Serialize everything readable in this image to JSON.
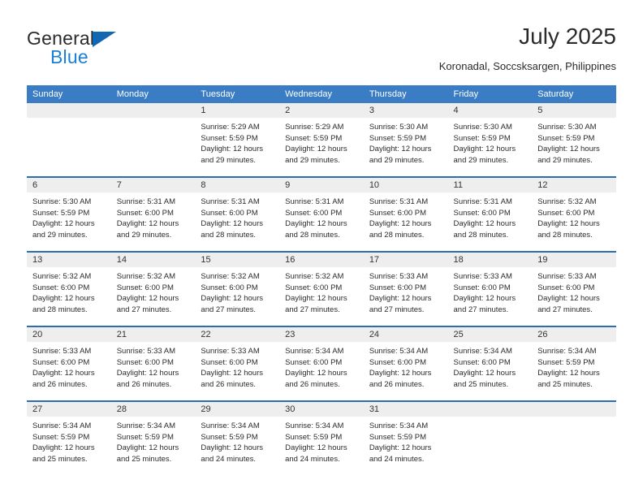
{
  "brand": {
    "name_part1": "General",
    "name_part2": "Blue",
    "triangle_icon": "triangle-icon",
    "colors": {
      "dark": "#2b2b2b",
      "blue": "#1b7fd4",
      "triangle": "#1167b1"
    }
  },
  "header": {
    "title": "July 2025",
    "subtitle": "Koronadal, Soccsksargen, Philippines"
  },
  "colors": {
    "header_row_bg": "#3b7dc4",
    "row_divider": "#2e6cb0",
    "date_band_bg": "#eeeeee",
    "cell_bg": "#ffffff",
    "text": "#2b2b2b"
  },
  "weekday_headers": [
    "Sunday",
    "Monday",
    "Tuesday",
    "Wednesday",
    "Thursday",
    "Friday",
    "Saturday"
  ],
  "labels": {
    "sunrise_prefix": "Sunrise:",
    "sunset_prefix": "Sunset:",
    "daylight_prefix": "Daylight:"
  },
  "weeks": [
    {
      "days": [
        {
          "date": "",
          "empty": true,
          "sunrise": "",
          "sunset": "",
          "daylight": ""
        },
        {
          "date": "",
          "empty": true,
          "sunrise": "",
          "sunset": "",
          "daylight": ""
        },
        {
          "date": "1",
          "empty": false,
          "sunrise": "Sunrise: 5:29 AM",
          "sunset": "Sunset: 5:59 PM",
          "daylight": "Daylight: 12 hours and 29 minutes."
        },
        {
          "date": "2",
          "empty": false,
          "sunrise": "Sunrise: 5:29 AM",
          "sunset": "Sunset: 5:59 PM",
          "daylight": "Daylight: 12 hours and 29 minutes."
        },
        {
          "date": "3",
          "empty": false,
          "sunrise": "Sunrise: 5:30 AM",
          "sunset": "Sunset: 5:59 PM",
          "daylight": "Daylight: 12 hours and 29 minutes."
        },
        {
          "date": "4",
          "empty": false,
          "sunrise": "Sunrise: 5:30 AM",
          "sunset": "Sunset: 5:59 PM",
          "daylight": "Daylight: 12 hours and 29 minutes."
        },
        {
          "date": "5",
          "empty": false,
          "sunrise": "Sunrise: 5:30 AM",
          "sunset": "Sunset: 5:59 PM",
          "daylight": "Daylight: 12 hours and 29 minutes."
        }
      ]
    },
    {
      "days": [
        {
          "date": "6",
          "empty": false,
          "sunrise": "Sunrise: 5:30 AM",
          "sunset": "Sunset: 5:59 PM",
          "daylight": "Daylight: 12 hours and 29 minutes."
        },
        {
          "date": "7",
          "empty": false,
          "sunrise": "Sunrise: 5:31 AM",
          "sunset": "Sunset: 6:00 PM",
          "daylight": "Daylight: 12 hours and 29 minutes."
        },
        {
          "date": "8",
          "empty": false,
          "sunrise": "Sunrise: 5:31 AM",
          "sunset": "Sunset: 6:00 PM",
          "daylight": "Daylight: 12 hours and 28 minutes."
        },
        {
          "date": "9",
          "empty": false,
          "sunrise": "Sunrise: 5:31 AM",
          "sunset": "Sunset: 6:00 PM",
          "daylight": "Daylight: 12 hours and 28 minutes."
        },
        {
          "date": "10",
          "empty": false,
          "sunrise": "Sunrise: 5:31 AM",
          "sunset": "Sunset: 6:00 PM",
          "daylight": "Daylight: 12 hours and 28 minutes."
        },
        {
          "date": "11",
          "empty": false,
          "sunrise": "Sunrise: 5:31 AM",
          "sunset": "Sunset: 6:00 PM",
          "daylight": "Daylight: 12 hours and 28 minutes."
        },
        {
          "date": "12",
          "empty": false,
          "sunrise": "Sunrise: 5:32 AM",
          "sunset": "Sunset: 6:00 PM",
          "daylight": "Daylight: 12 hours and 28 minutes."
        }
      ]
    },
    {
      "days": [
        {
          "date": "13",
          "empty": false,
          "sunrise": "Sunrise: 5:32 AM",
          "sunset": "Sunset: 6:00 PM",
          "daylight": "Daylight: 12 hours and 28 minutes."
        },
        {
          "date": "14",
          "empty": false,
          "sunrise": "Sunrise: 5:32 AM",
          "sunset": "Sunset: 6:00 PM",
          "daylight": "Daylight: 12 hours and 27 minutes."
        },
        {
          "date": "15",
          "empty": false,
          "sunrise": "Sunrise: 5:32 AM",
          "sunset": "Sunset: 6:00 PM",
          "daylight": "Daylight: 12 hours and 27 minutes."
        },
        {
          "date": "16",
          "empty": false,
          "sunrise": "Sunrise: 5:32 AM",
          "sunset": "Sunset: 6:00 PM",
          "daylight": "Daylight: 12 hours and 27 minutes."
        },
        {
          "date": "17",
          "empty": false,
          "sunrise": "Sunrise: 5:33 AM",
          "sunset": "Sunset: 6:00 PM",
          "daylight": "Daylight: 12 hours and 27 minutes."
        },
        {
          "date": "18",
          "empty": false,
          "sunrise": "Sunrise: 5:33 AM",
          "sunset": "Sunset: 6:00 PM",
          "daylight": "Daylight: 12 hours and 27 minutes."
        },
        {
          "date": "19",
          "empty": false,
          "sunrise": "Sunrise: 5:33 AM",
          "sunset": "Sunset: 6:00 PM",
          "daylight": "Daylight: 12 hours and 27 minutes."
        }
      ]
    },
    {
      "days": [
        {
          "date": "20",
          "empty": false,
          "sunrise": "Sunrise: 5:33 AM",
          "sunset": "Sunset: 6:00 PM",
          "daylight": "Daylight: 12 hours and 26 minutes."
        },
        {
          "date": "21",
          "empty": false,
          "sunrise": "Sunrise: 5:33 AM",
          "sunset": "Sunset: 6:00 PM",
          "daylight": "Daylight: 12 hours and 26 minutes."
        },
        {
          "date": "22",
          "empty": false,
          "sunrise": "Sunrise: 5:33 AM",
          "sunset": "Sunset: 6:00 PM",
          "daylight": "Daylight: 12 hours and 26 minutes."
        },
        {
          "date": "23",
          "empty": false,
          "sunrise": "Sunrise: 5:34 AM",
          "sunset": "Sunset: 6:00 PM",
          "daylight": "Daylight: 12 hours and 26 minutes."
        },
        {
          "date": "24",
          "empty": false,
          "sunrise": "Sunrise: 5:34 AM",
          "sunset": "Sunset: 6:00 PM",
          "daylight": "Daylight: 12 hours and 26 minutes."
        },
        {
          "date": "25",
          "empty": false,
          "sunrise": "Sunrise: 5:34 AM",
          "sunset": "Sunset: 6:00 PM",
          "daylight": "Daylight: 12 hours and 25 minutes."
        },
        {
          "date": "26",
          "empty": false,
          "sunrise": "Sunrise: 5:34 AM",
          "sunset": "Sunset: 5:59 PM",
          "daylight": "Daylight: 12 hours and 25 minutes."
        }
      ]
    },
    {
      "days": [
        {
          "date": "27",
          "empty": false,
          "sunrise": "Sunrise: 5:34 AM",
          "sunset": "Sunset: 5:59 PM",
          "daylight": "Daylight: 12 hours and 25 minutes."
        },
        {
          "date": "28",
          "empty": false,
          "sunrise": "Sunrise: 5:34 AM",
          "sunset": "Sunset: 5:59 PM",
          "daylight": "Daylight: 12 hours and 25 minutes."
        },
        {
          "date": "29",
          "empty": false,
          "sunrise": "Sunrise: 5:34 AM",
          "sunset": "Sunset: 5:59 PM",
          "daylight": "Daylight: 12 hours and 24 minutes."
        },
        {
          "date": "30",
          "empty": false,
          "sunrise": "Sunrise: 5:34 AM",
          "sunset": "Sunset: 5:59 PM",
          "daylight": "Daylight: 12 hours and 24 minutes."
        },
        {
          "date": "31",
          "empty": false,
          "sunrise": "Sunrise: 5:34 AM",
          "sunset": "Sunset: 5:59 PM",
          "daylight": "Daylight: 12 hours and 24 minutes."
        },
        {
          "date": "",
          "empty": true,
          "sunrise": "",
          "sunset": "",
          "daylight": ""
        },
        {
          "date": "",
          "empty": true,
          "sunrise": "",
          "sunset": "",
          "daylight": ""
        }
      ]
    }
  ]
}
